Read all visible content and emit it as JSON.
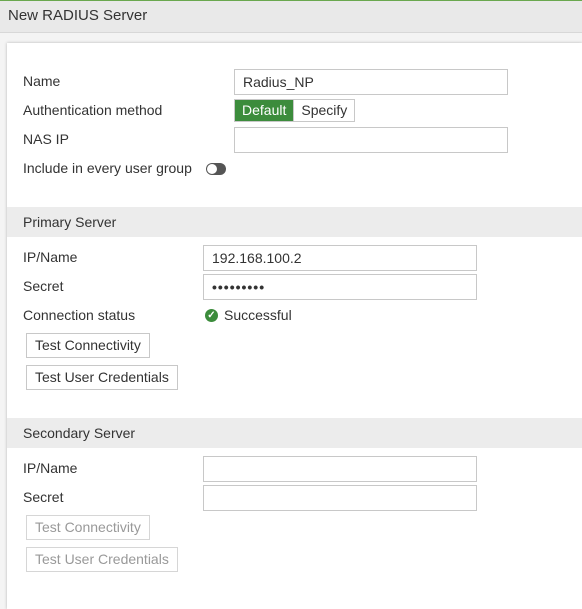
{
  "window": {
    "title": "New RADIUS Server"
  },
  "form": {
    "name_label": "Name",
    "name_value": "Radius_NP",
    "auth_label": "Authentication method",
    "auth_options": [
      "Default",
      "Specify"
    ],
    "auth_selected": "Default",
    "nas_ip_label": "NAS IP",
    "nas_ip_value": "",
    "include_label": "Include in every user group",
    "include_enabled": false
  },
  "primary": {
    "title": "Primary Server",
    "ip_label": "IP/Name",
    "ip_value": "192.168.100.2",
    "secret_label": "Secret",
    "secret_value": "•••••••••",
    "status_label": "Connection status",
    "status_value": "Successful",
    "status_color": "#3c8c3c",
    "test_conn_label": "Test Connectivity",
    "test_cred_label": "Test User Credentials"
  },
  "secondary": {
    "title": "Secondary Server",
    "ip_label": "IP/Name",
    "ip_value": "",
    "secret_label": "Secret",
    "secret_value": "",
    "test_conn_label": "Test Connectivity",
    "test_cred_label": "Test User Credentials"
  },
  "icons": {
    "status": "check-circle-icon"
  }
}
